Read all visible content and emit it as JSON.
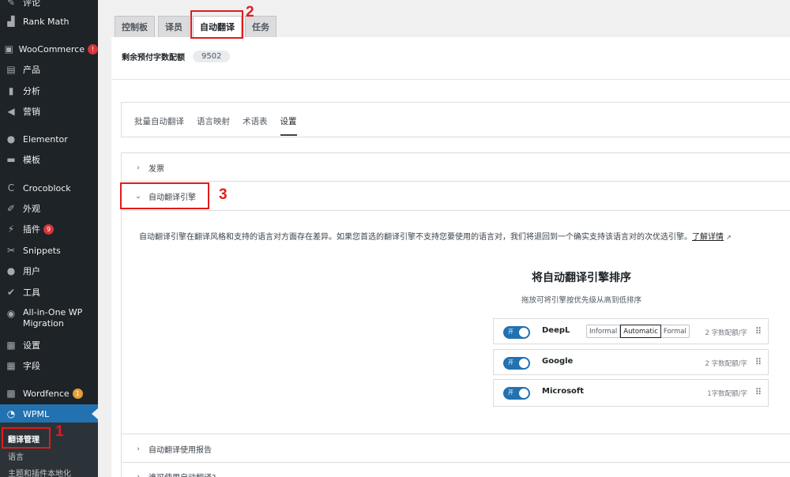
{
  "sidebar": {
    "items": [
      {
        "icon": "comment-icon",
        "label": "评论"
      },
      {
        "icon": "rank-math-icon",
        "label": "Rank Math"
      },
      {
        "icon": "woocommerce-icon",
        "label": "WooCommerce",
        "badge": "!"
      },
      {
        "icon": "products-icon",
        "label": "产品"
      },
      {
        "icon": "analytics-icon",
        "label": "分析"
      },
      {
        "icon": "marketing-icon",
        "label": "营销"
      },
      {
        "icon": "elementor-icon",
        "label": "Elementor"
      },
      {
        "icon": "templates-icon",
        "label": "模板"
      },
      {
        "icon": "crocoblock-icon",
        "label": "Crocoblock"
      },
      {
        "icon": "appearance-icon",
        "label": "外观"
      },
      {
        "icon": "plugins-icon",
        "label": "插件",
        "badge": "9"
      },
      {
        "icon": "snippets-icon",
        "label": "Snippets"
      },
      {
        "icon": "users-icon",
        "label": "用户"
      },
      {
        "icon": "tools-icon",
        "label": "工具"
      },
      {
        "icon": "migration-icon",
        "label": "All-in-One WP Migration"
      },
      {
        "icon": "settings-icon",
        "label": "设置"
      },
      {
        "icon": "fields-icon",
        "label": "字段"
      },
      {
        "icon": "wordfence-icon",
        "label": "Wordfence",
        "badge": "1"
      },
      {
        "icon": "wpml-icon",
        "label": "WPML"
      }
    ],
    "submenu": [
      "翻译管理",
      "语言",
      "主题和插件本地化"
    ]
  },
  "top_tabs": [
    "控制板",
    "译员",
    "自动翻译",
    "任务"
  ],
  "quota": {
    "label": "剩余预付字数配额",
    "value": "9502"
  },
  "sub_tabs": [
    "批量自动翻译",
    "语言映射",
    "术语表",
    "设置"
  ],
  "accordions": {
    "invoice": "发票",
    "engines": "自动翻译引擎",
    "usage_report": "自动翻译使用报告",
    "who_can": "谁可使用自动翻译?"
  },
  "description": {
    "text": "自动翻译引擎在翻译风格和支持的语言对方面存在差异。如果您首选的翻译引擎不支持您要使用的语言对，我们将退回到一个确实支持该语言对的次优选引擎。",
    "link": "了解详情"
  },
  "engines_panel": {
    "title": "将自动翻译引擎排序",
    "subtitle": "拖放可将引擎按优先级从高到低排序",
    "toggle_on": "开",
    "engines": [
      {
        "name": "DeepL",
        "quota": "2 字数配额/字",
        "styles": [
          "Informal",
          "Automatic",
          "Formal"
        ],
        "selected_style": "Automatic"
      },
      {
        "name": "Google",
        "quota": "2 字数配额/字"
      },
      {
        "name": "Microsoft",
        "quota": "1字数配额/字"
      }
    ]
  },
  "annotations": {
    "step1": "1",
    "step2": "2",
    "step3": "3"
  },
  "colors": {
    "sidebar_bg": "#1d2327",
    "accent": "#2271b1",
    "annotation_red": "#e21b1b"
  }
}
